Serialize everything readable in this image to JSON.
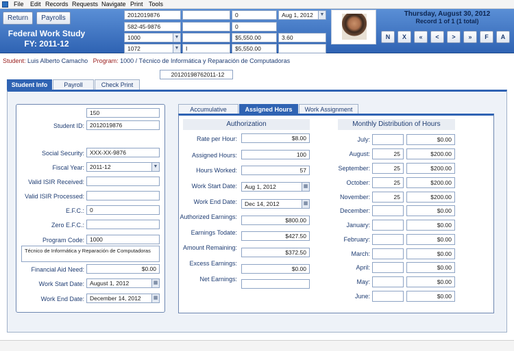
{
  "menu": [
    "File",
    "Edit",
    "Records",
    "Requests",
    "Navigate",
    "Print",
    "Tools"
  ],
  "header": {
    "return_label": "Return",
    "payrolls_label": "Payrolls",
    "app_title": "Federal Work Study",
    "fiscal_year_title": "FY: 2011-12",
    "date_text": "Thursday, August 30, 2012",
    "record_text": "Record 1 of 1 (1 total)",
    "nav_buttons": [
      "N",
      "X",
      "«",
      "<",
      ">",
      "»",
      "F",
      "A"
    ],
    "fields": {
      "r1c1": "2012019876",
      "r1c2": "",
      "r1c3": "0",
      "r1c4": "Aug 1, 2012",
      "r2c1": "582-45-9876",
      "r2c2": "",
      "r2c3": "0",
      "r3c1": "1000",
      "r3c2": "",
      "r3c3": "$5,550.00",
      "r3c4": "3.60",
      "r4c1": "1072",
      "r4c2": "I",
      "r4c3": "$5,550.00",
      "r4c4": ""
    }
  },
  "info": {
    "student_label": "Student:",
    "student_name": "Luis Alberto Camacho",
    "program_label": "Program:",
    "program_value": "1000  /  Técnico de Informática y Reparación de Computadoras",
    "record_id": "20120198762011-12"
  },
  "main_tabs": [
    "Student Info",
    "Payroll",
    "Check Print"
  ],
  "student": {
    "top_value": "150",
    "student_id_label": "Student ID:",
    "student_id": "2012019876",
    "ssn_label": "Social Security:",
    "ssn": "XXX-XX-9876",
    "fiscal_year_label": "Fiscal Year:",
    "fiscal_year": "2011-12",
    "isir_received_label": "Valid ISIR Received:",
    "isir_received": "",
    "isir_processed_label": "Valid ISIR Processed:",
    "isir_processed": "",
    "efc_label": "E.F.C.:",
    "efc": "0",
    "zero_efc_label": "Zero E.F.C.:",
    "zero_efc": "",
    "program_code_label": "Program Code:",
    "program_code": "1000",
    "program_desc": "Técnico de Informática y Reparación de Computadoras",
    "fin_aid_label": "Financial Aid Need:",
    "fin_aid": "$0.00",
    "work_start_label": "Work Start Date:",
    "work_start": "August 1, 2012",
    "work_end_label": "Work End Date:",
    "work_end": "December 14, 2012"
  },
  "sub_tabs": [
    "Accumulative",
    "Assigned Hours",
    "Work Assignment"
  ],
  "authorization": {
    "title": "Authorization",
    "rows": [
      {
        "label": "Rate per Hour:",
        "value": "$8.00"
      },
      {
        "label": "Assigned Hours:",
        "value": "100"
      },
      {
        "label": "Hours Worked:",
        "value": "57"
      },
      {
        "label": "Work Start Date:",
        "value": "Aug 1, 2012"
      },
      {
        "label": "Work End Date:",
        "value": "Dec 14, 2012"
      },
      {
        "label": "Authorized Earnings:",
        "value": "$800.00"
      },
      {
        "label": "Earnings Todate:",
        "value": "$427.50"
      },
      {
        "label": "Amount Remaining:",
        "value": "$372.50"
      },
      {
        "label": "Excess Earnings:",
        "value": "$0.00"
      },
      {
        "label": "Net Earnings:",
        "value": ""
      }
    ]
  },
  "monthly": {
    "title": "Monthly Distribution of Hours",
    "rows": [
      {
        "month": "July:",
        "hours": "",
        "amount": "$0.00"
      },
      {
        "month": "August:",
        "hours": "25",
        "amount": "$200.00"
      },
      {
        "month": "September:",
        "hours": "25",
        "amount": "$200.00"
      },
      {
        "month": "October:",
        "hours": "25",
        "amount": "$200.00"
      },
      {
        "month": "November:",
        "hours": "25",
        "amount": "$200.00"
      },
      {
        "month": "December:",
        "hours": "",
        "amount": "$0.00"
      },
      {
        "month": "January:",
        "hours": "",
        "amount": "$0.00"
      },
      {
        "month": "February:",
        "hours": "",
        "amount": "$0.00"
      },
      {
        "month": "March:",
        "hours": "",
        "amount": "$0.00"
      },
      {
        "month": "April:",
        "hours": "",
        "amount": "$0.00"
      },
      {
        "month": "May:",
        "hours": "",
        "amount": "$0.00"
      },
      {
        "month": "June:",
        "hours": "",
        "amount": "$0.00"
      }
    ]
  }
}
